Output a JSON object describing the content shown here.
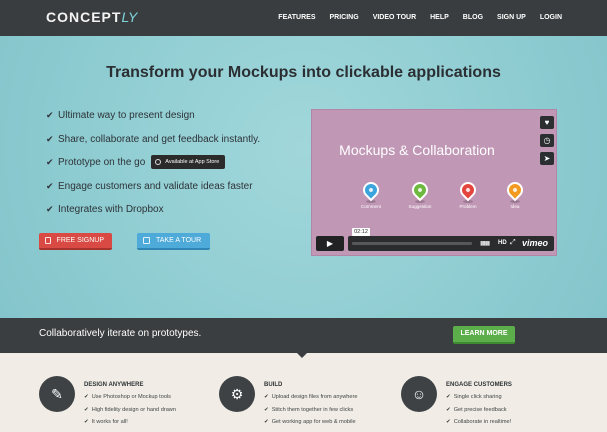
{
  "header": {
    "logo_main": "CONCEPT",
    "logo_suffix": "LY",
    "nav": [
      "FEATURES",
      "PRICING",
      "VIDEO TOUR",
      "HELP",
      "BLOG",
      "SIGN UP",
      "LOGIN"
    ]
  },
  "hero": {
    "headline": "Transform your Mockups into clickable applications",
    "features": [
      "Ultimate way to present design",
      "Share, collaborate and get feedback instantly.",
      "Prototype on the go",
      "Engage customers and validate ideas faster",
      "Integrates with Dropbox"
    ],
    "appstore_label": "Available at App Store",
    "signup_label": "FREE SIGNUP",
    "tour_label": "TAKE A TOUR"
  },
  "video": {
    "title": "Mockups & Collaboration",
    "pins": [
      "Comment",
      "Suggestion",
      "Problem",
      "Idea"
    ],
    "timecode": "02:12",
    "hd": "HD",
    "brand": "vimeo",
    "progress": 0.02,
    "icons": [
      "heart-icon",
      "clock-icon",
      "send-icon",
      "play-icon",
      "volume-icon",
      "fullscreen-icon"
    ]
  },
  "band": {
    "text": "Collaboratively iterate on prototypes.",
    "learn_more": "LEARN MORE"
  },
  "columns": [
    {
      "title": "DESIGN ANYWHERE",
      "icon": "design-tools-icon",
      "items": [
        "Use Photoshop or Mockup tools",
        "High fidelity design or hand drawn",
        "It works for all!"
      ]
    },
    {
      "title": "BUILD",
      "icon": "gears-icon",
      "items": [
        "Upload design files from anywhere",
        "Stitch them together in few clicks",
        "Get working app for web & mobile"
      ]
    },
    {
      "title": "ENGAGE CUSTOMERS",
      "icon": "users-icon",
      "items": [
        "Single click sharing",
        "Get precise feedback",
        "Collaborate in realtime!"
      ]
    }
  ],
  "colors": {
    "hero_bg": "#93cfd4",
    "header_bg": "#3a3d3f",
    "signup": "#d84a43",
    "tour": "#4daad9",
    "learn_more": "#5cae4b",
    "video_bg": "#c197b6"
  }
}
